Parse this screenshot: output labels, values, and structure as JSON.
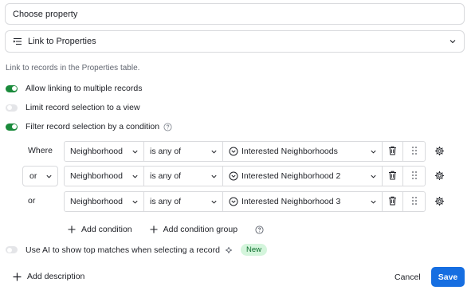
{
  "field_name": {
    "value": "Choose property"
  },
  "field_type": {
    "label": "Link to Properties",
    "icon": "link-list-icon"
  },
  "help_text": "Link to records in the Properties table.",
  "toggles": [
    {
      "label": "Allow linking to multiple records",
      "on": true
    },
    {
      "label": "Limit record selection to a view",
      "on": false
    },
    {
      "label": "Filter record selection by a condition",
      "on": true
    }
  ],
  "conditions": [
    {
      "conjunction": "Where",
      "conjunction_editable": false,
      "field": "Neighborhood",
      "operator": "is any of",
      "value": "Interested Neighborhoods"
    },
    {
      "conjunction": "or",
      "conjunction_editable": true,
      "field": "Neighborhood",
      "operator": "is any of",
      "value": "Interested Neighborhood 2"
    },
    {
      "conjunction": "or",
      "conjunction_editable": false,
      "field": "Neighborhood",
      "operator": "is any of",
      "value": "Interested Neighborhood 3"
    }
  ],
  "add_condition_label": "Add condition",
  "add_condition_group_label": "Add condition group",
  "ai_toggle": {
    "label": "Use AI to show top matches when selecting a record",
    "on": false,
    "badge": "New"
  },
  "footer": {
    "add_description": "Add description",
    "cancel": "Cancel",
    "save": "Save"
  },
  "colors": {
    "toggle_on": "#1a8a3b",
    "primary": "#166ee1",
    "badge_bg": "#d4f5dc",
    "badge_text": "#0b6e2b"
  }
}
